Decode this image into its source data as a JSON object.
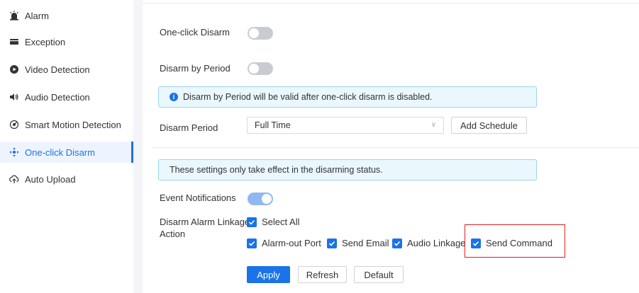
{
  "sidebar": {
    "items": [
      {
        "label": "Alarm",
        "icon": "alarm-siren-icon"
      },
      {
        "label": "Exception",
        "icon": "exception-card-icon"
      },
      {
        "label": "Video Detection",
        "icon": "video-detection-icon"
      },
      {
        "label": "Audio Detection",
        "icon": "speaker-icon"
      },
      {
        "label": "Smart Motion Detection",
        "icon": "motion-radar-icon"
      },
      {
        "label": "One-click Disarm",
        "icon": "disarm-move-icon"
      },
      {
        "label": "Auto Upload",
        "icon": "upload-cloud-icon"
      }
    ],
    "active_index": 5
  },
  "form": {
    "one_click_disarm": {
      "label": "One-click Disarm",
      "enabled": false
    },
    "disarm_by_period": {
      "label": "Disarm by Period",
      "enabled": false
    },
    "period_notice": "Disarm by Period will be valid after one-click disarm is disabled.",
    "disarm_period": {
      "label": "Disarm Period",
      "value": "Full Time",
      "add_schedule": "Add Schedule"
    },
    "status_notice": "These settings only take effect in the disarming status.",
    "event_notifications": {
      "label": "Event Notifications",
      "enabled": true
    },
    "linkage": {
      "label_line1": "Disarm Alarm Linkage",
      "label_line2": "Action",
      "select_all": "Select All",
      "options": [
        {
          "label": "Alarm-out Port",
          "checked": true
        },
        {
          "label": "Send Email",
          "checked": true
        },
        {
          "label": "Audio Linkage",
          "checked": true
        },
        {
          "label": "Send Command",
          "checked": true
        }
      ]
    }
  },
  "actions": {
    "apply": "Apply",
    "refresh": "Refresh",
    "default": "Default"
  },
  "colors": {
    "accent": "#1a73e8",
    "highlight": "#e02020",
    "notice_bg": "#eaf7fd"
  }
}
